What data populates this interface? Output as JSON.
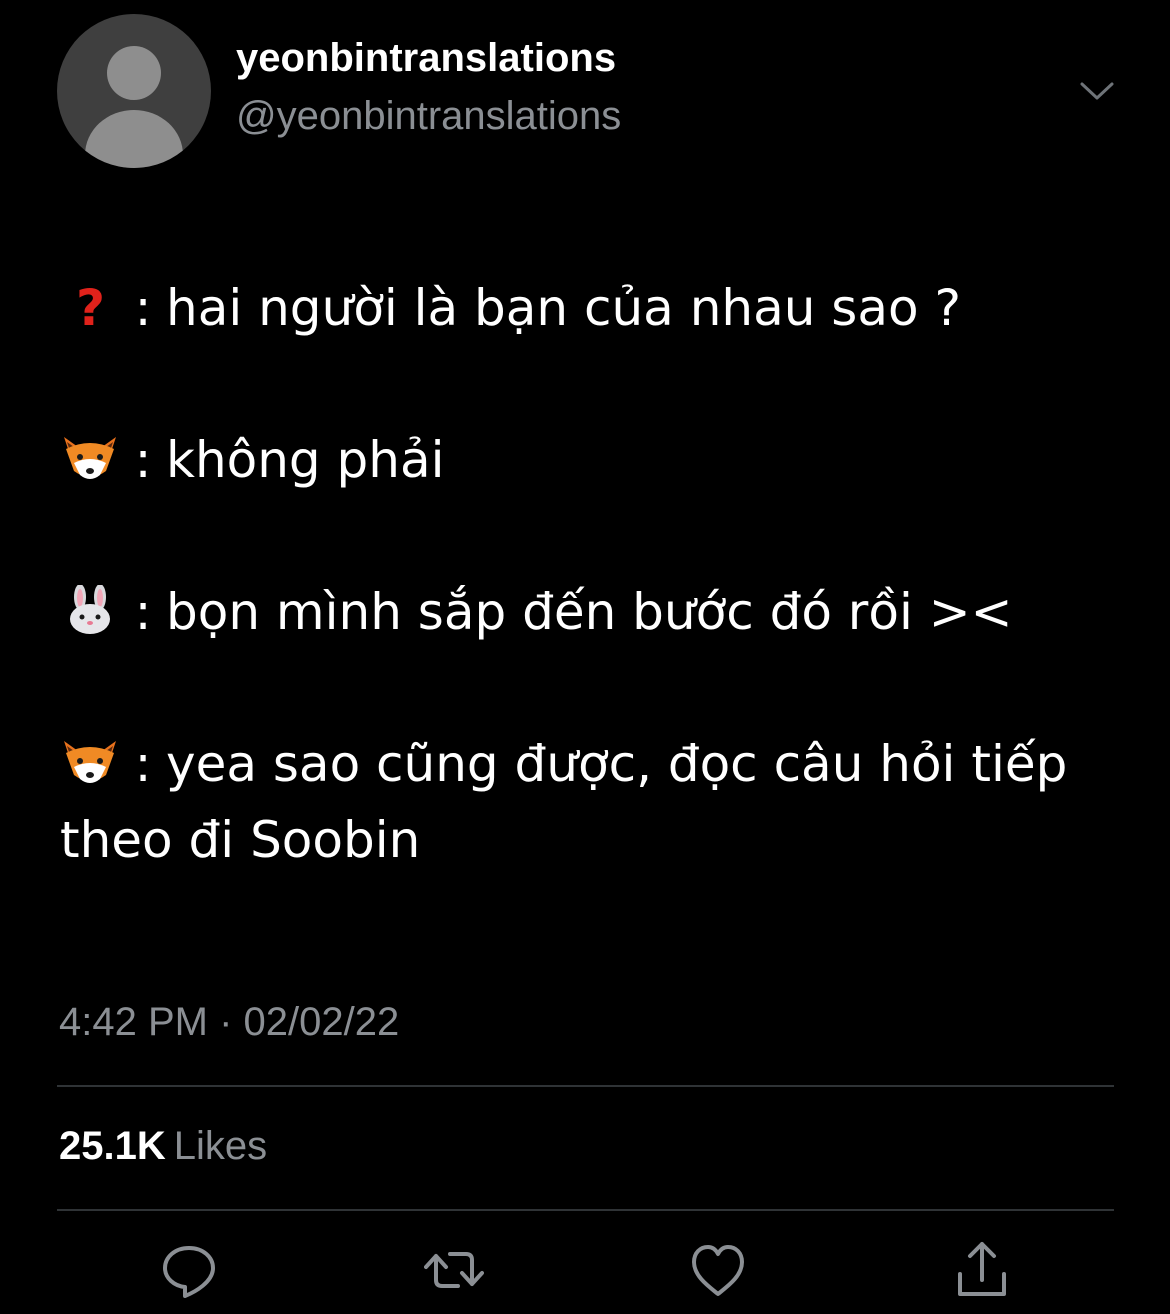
{
  "user": {
    "display_name": "yeonbintranslations",
    "handle": "@yeonbintranslations"
  },
  "tweet": {
    "lines": [
      {
        "speaker_icon": "red-question-mark-icon",
        "separator": ":",
        "text": "hai người là bạn của nhau sao ?"
      },
      {
        "speaker_icon": "fox-face-icon",
        "separator": ":",
        "text": "không phải"
      },
      {
        "speaker_icon": "rabbit-face-icon",
        "separator": ":",
        "text": "bọn mình sắp đến bước đó rồi ><"
      },
      {
        "speaker_icon": "fox-face-icon",
        "separator": ":",
        "text": "yea sao cũng được, đọc câu hỏi tiếp theo đi Soobin"
      }
    ],
    "timestamp": "4:42 PM · 02/02/22"
  },
  "stats": {
    "likes_count": "25.1K",
    "likes_label": "Likes"
  },
  "actions": {
    "reply_icon": "reply-icon",
    "retweet_icon": "retweet-icon",
    "like_icon": "heart-icon",
    "share_icon": "share-icon"
  },
  "colors": {
    "background": "#000000",
    "primary_text": "#ffffff",
    "secondary_text": "#8b8f94",
    "divider": "#2f3336",
    "question_mark": "#e0221b"
  }
}
